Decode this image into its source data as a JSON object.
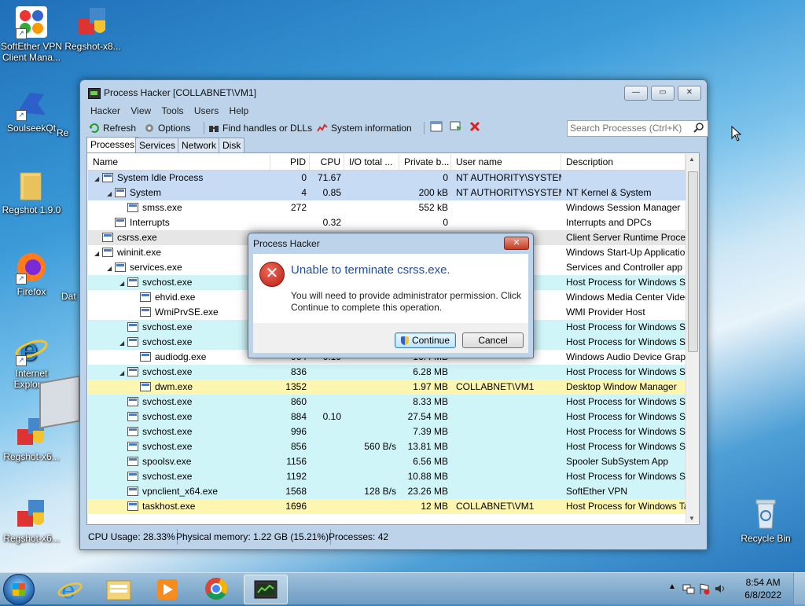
{
  "desktop": {
    "icons": [
      {
        "label": "SoftEther VPN Client Mana...",
        "icon": "vpn-client-icon"
      },
      {
        "label": "Regshot-x8...",
        "icon": "regshot-icon"
      },
      {
        "label": "SoulseekQt",
        "icon": "soulseek-icon"
      },
      {
        "label": "Regshot 1.9.0",
        "icon": "folder-icon"
      },
      {
        "label": "Firefox",
        "icon": "firefox-icon"
      },
      {
        "label": "Internet Explorer",
        "icon": "ie-icon"
      },
      {
        "label": "Regshot-x6...",
        "icon": "regshot-icon"
      },
      {
        "label": "Regshot-x6...",
        "icon": "regshot-icon"
      },
      {
        "label": "Recycle Bin",
        "icon": "recycle-bin-icon"
      }
    ],
    "partial_labels": [
      "Re",
      "Dat",
      "Re"
    ]
  },
  "window": {
    "title": "Process Hacker [COLLABNET\\VM1]",
    "menu": [
      "Hacker",
      "View",
      "Tools",
      "Users",
      "Help"
    ],
    "toolbar": {
      "refresh": "Refresh",
      "options": "Options",
      "find_handles": "Find handles or DLLs",
      "system_info": "System information"
    },
    "search_placeholder": "Search Processes (Ctrl+K)",
    "tabs": [
      "Processes",
      "Services",
      "Network",
      "Disk"
    ],
    "columns": [
      "Name",
      "PID",
      "CPU",
      "I/O total ...",
      "Private b...",
      "User name",
      "Description"
    ],
    "rows": [
      {
        "name": "System Idle Process",
        "pid": "0",
        "cpu": "71.67",
        "io": "",
        "priv": "0",
        "user": "NT AUTHORITY\\SYSTEM",
        "desc": "",
        "depth": 0,
        "expand": "◢",
        "color": "#c7dbf5"
      },
      {
        "name": "System",
        "pid": "4",
        "cpu": "0.85",
        "io": "",
        "priv": "200 kB",
        "user": "NT AUTHORITY\\SYSTEM",
        "desc": "NT Kernel & System",
        "depth": 1,
        "expand": "◢",
        "color": "#c7dbf5"
      },
      {
        "name": "smss.exe",
        "pid": "272",
        "cpu": "",
        "io": "",
        "priv": "552 kB",
        "user": "",
        "desc": "Windows Session Manager",
        "depth": 2,
        "expand": "",
        "color": "#ffffff"
      },
      {
        "name": "Interrupts",
        "pid": "",
        "cpu": "0.32",
        "io": "",
        "priv": "0",
        "user": "",
        "desc": "Interrupts and DPCs",
        "depth": 1,
        "expand": "",
        "color": "#ffffff"
      },
      {
        "name": "csrss.exe",
        "pid": "",
        "cpu": "",
        "io": "",
        "priv": "",
        "user": "",
        "desc": "Client Server Runtime Process",
        "depth": 0,
        "expand": "",
        "color": "#e6e6e6"
      },
      {
        "name": "wininit.exe",
        "pid": "",
        "cpu": "",
        "io": "",
        "priv": "",
        "user": "",
        "desc": "Windows Start-Up Application",
        "depth": 0,
        "expand": "◢",
        "color": "#ffffff"
      },
      {
        "name": "services.exe",
        "pid": "",
        "cpu": "",
        "io": "",
        "priv": "",
        "user": "",
        "desc": "Services and Controller app",
        "depth": 1,
        "expand": "◢",
        "color": "#ffffff"
      },
      {
        "name": "svchost.exe",
        "pid": "",
        "cpu": "",
        "io": "",
        "priv": "",
        "user": "",
        "desc": "Host Process for Windows Ser...",
        "depth": 2,
        "expand": "◢",
        "color": "#d0f5f9"
      },
      {
        "name": "ehvid.exe",
        "pid": "",
        "cpu": "",
        "io": "",
        "priv": "",
        "user": "",
        "desc": "Windows Media Center Video ...",
        "depth": 3,
        "expand": "",
        "color": "#ffffff"
      },
      {
        "name": "WmiPrvSE.exe",
        "pid": "",
        "cpu": "",
        "io": "",
        "priv": "",
        "user": "",
        "desc": "WMI Provider Host",
        "depth": 3,
        "expand": "",
        "color": "#ffffff"
      },
      {
        "name": "svchost.exe",
        "pid": "",
        "cpu": "",
        "io": "",
        "priv": "",
        "user": "",
        "desc": "Host Process for Windows Ser...",
        "depth": 2,
        "expand": "",
        "color": "#d0f5f9"
      },
      {
        "name": "svchost.exe",
        "pid": "",
        "cpu": "",
        "io": "",
        "priv": "",
        "user": "",
        "desc": "Host Process for Windows Ser...",
        "depth": 2,
        "expand": "◢",
        "color": "#d0f5f9"
      },
      {
        "name": "audiodg.exe",
        "pid": "964",
        "cpu": "0.19",
        "io": "",
        "priv": "16.4 MB",
        "user": "",
        "desc": "Windows Audio Device Graph...",
        "depth": 3,
        "expand": "",
        "color": "#ffffff"
      },
      {
        "name": "svchost.exe",
        "pid": "836",
        "cpu": "",
        "io": "",
        "priv": "6.28 MB",
        "user": "",
        "desc": "Host Process for Windows Ser...",
        "depth": 2,
        "expand": "◢",
        "color": "#d0f5f9"
      },
      {
        "name": "dwm.exe",
        "pid": "1352",
        "cpu": "",
        "io": "",
        "priv": "1.97 MB",
        "user": "COLLABNET\\VM1",
        "desc": "Desktop Window Manager",
        "depth": 3,
        "expand": "",
        "color": "#fdf6b0"
      },
      {
        "name": "svchost.exe",
        "pid": "860",
        "cpu": "",
        "io": "",
        "priv": "8.33 MB",
        "user": "",
        "desc": "Host Process for Windows Ser...",
        "depth": 2,
        "expand": "",
        "color": "#d0f5f9"
      },
      {
        "name": "svchost.exe",
        "pid": "884",
        "cpu": "0.10",
        "io": "",
        "priv": "27.54 MB",
        "user": "",
        "desc": "Host Process for Windows Ser...",
        "depth": 2,
        "expand": "",
        "color": "#d0f5f9"
      },
      {
        "name": "svchost.exe",
        "pid": "996",
        "cpu": "",
        "io": "",
        "priv": "7.39 MB",
        "user": "",
        "desc": "Host Process for Windows Ser...",
        "depth": 2,
        "expand": "",
        "color": "#d0f5f9"
      },
      {
        "name": "svchost.exe",
        "pid": "856",
        "cpu": "",
        "io": "560 B/s",
        "priv": "13.81 MB",
        "user": "",
        "desc": "Host Process for Windows Ser...",
        "depth": 2,
        "expand": "",
        "color": "#d0f5f9"
      },
      {
        "name": "spoolsv.exe",
        "pid": "1156",
        "cpu": "",
        "io": "",
        "priv": "6.56 MB",
        "user": "",
        "desc": "Spooler SubSystem App",
        "depth": 2,
        "expand": "",
        "color": "#d0f5f9"
      },
      {
        "name": "svchost.exe",
        "pid": "1192",
        "cpu": "",
        "io": "",
        "priv": "10.88 MB",
        "user": "",
        "desc": "Host Process for Windows Ser...",
        "depth": 2,
        "expand": "",
        "color": "#d0f5f9"
      },
      {
        "name": "vpnclient_x64.exe",
        "pid": "1568",
        "cpu": "",
        "io": "128 B/s",
        "priv": "23.26 MB",
        "user": "",
        "desc": "SoftEther VPN",
        "depth": 2,
        "expand": "",
        "color": "#d0f5f9"
      },
      {
        "name": "taskhost.exe",
        "pid": "1696",
        "cpu": "",
        "io": "",
        "priv": "12 MB",
        "user": "COLLABNET\\VM1",
        "desc": "Host Process for Windows Tas...",
        "depth": 2,
        "expand": "",
        "color": "#fdf6b0"
      }
    ],
    "status": {
      "cpu": "CPU Usage: 28.33%",
      "memory": "Physical memory: 1.22 GB (15.21%)",
      "processes": "Processes: 42"
    }
  },
  "dialog": {
    "title": "Process Hacker",
    "close_glyph": "✕",
    "main_instruction": "Unable to terminate csrss.exe.",
    "content": "You will need to provide administrator permission. Click Continue to complete this operation.",
    "continue_label": "Continue",
    "cancel_label": "Cancel",
    "icon": "error-icon"
  },
  "taskbar": {
    "time": "8:54 AM",
    "date": "6/8/2022",
    "pinned": [
      "ie-icon",
      "explorer-icon",
      "media-player-icon",
      "chrome-icon",
      "process-hacker-icon"
    ]
  },
  "colors": {
    "service": "#d0f5f9",
    "own_process": "#fdf6b0",
    "system": "#c7dbf5",
    "accent": "#1f4fa8"
  }
}
